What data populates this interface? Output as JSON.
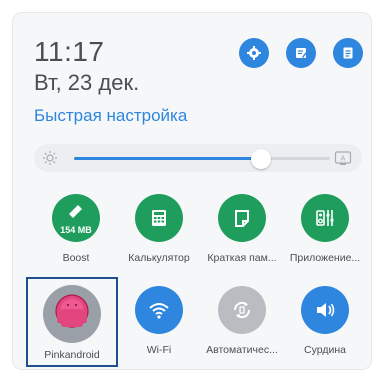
{
  "time": "11:17",
  "date": "Вт, 23 дек.",
  "quick_settings_title": "Быстрая настройка",
  "brightness": {
    "level": 0.73
  },
  "top_buttons": [
    {
      "icon": "gear-icon"
    },
    {
      "icon": "edit-icon"
    },
    {
      "icon": "notes-icon"
    }
  ],
  "tiles": [
    {
      "label": "Boost",
      "badge": "154 MB",
      "icon": "broom-icon",
      "color": "#1f9d5c"
    },
    {
      "label": "Калькулятор",
      "icon": "calculator-icon",
      "color": "#1f9d5c"
    },
    {
      "label": "Краткая пам...",
      "icon": "quick-memo-icon",
      "color": "#1f9d5c"
    },
    {
      "label": "Приложение...",
      "icon": "equalizer-icon",
      "color": "#1f9d5c"
    },
    {
      "label": "Pinkandroid",
      "icon": "pink-android-photo",
      "color": "#e2467f"
    },
    {
      "label": "Wi-Fi",
      "icon": "wifi-icon",
      "color": "#2e86de"
    },
    {
      "label": "Автоматичес...",
      "icon": "auto-rotate-icon",
      "color": "#b9bcc1"
    },
    {
      "label": "Сурдина",
      "icon": "volume-icon",
      "color": "#2e86de"
    }
  ],
  "colors": {
    "accent": "#2e86de",
    "green": "#1f9d5c",
    "disabled": "#b9bcc1",
    "selection_border": "#1e4f8f"
  }
}
